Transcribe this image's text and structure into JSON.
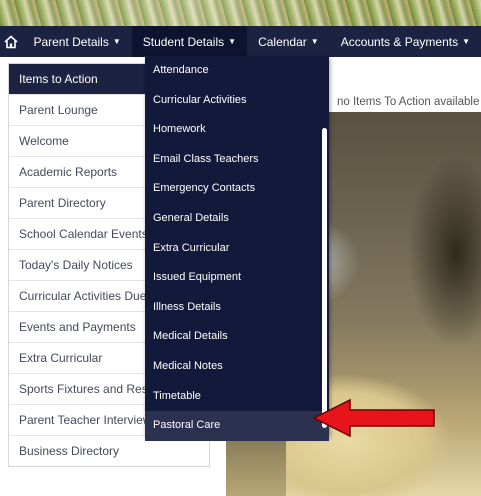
{
  "nav": {
    "home_icon": "home-icon",
    "items": [
      {
        "label": "Parent Details"
      },
      {
        "label": "Student Details"
      },
      {
        "label": "Calendar"
      },
      {
        "label": "Accounts & Payments"
      }
    ]
  },
  "sidebar": {
    "items": [
      {
        "label": "Items to Action"
      },
      {
        "label": "Parent Lounge"
      },
      {
        "label": "Welcome"
      },
      {
        "label": "Academic Reports"
      },
      {
        "label": "Parent Directory"
      },
      {
        "label": "School Calendar Events"
      },
      {
        "label": "Today's Daily Notices"
      },
      {
        "label": "Curricular Activities Due"
      },
      {
        "label": "Events and Payments"
      },
      {
        "label": "Extra Curricular"
      },
      {
        "label": "Sports Fixtures and Res"
      },
      {
        "label": "Parent Teacher Interview"
      },
      {
        "label": "Business Directory"
      }
    ]
  },
  "main": {
    "notice": "no Items To Action available"
  },
  "dropdown": {
    "items": [
      {
        "label": "Attendance"
      },
      {
        "label": "Curricular Activities"
      },
      {
        "label": "Homework"
      },
      {
        "label": "Email Class Teachers"
      },
      {
        "label": "Emergency Contacts"
      },
      {
        "label": "General Details"
      },
      {
        "label": "Extra Curricular"
      },
      {
        "label": "Issued Equipment"
      },
      {
        "label": "Illness Details"
      },
      {
        "label": "Medical Details"
      },
      {
        "label": "Medical Notes"
      },
      {
        "label": "Timetable"
      },
      {
        "label": "Pastoral Care"
      }
    ]
  },
  "colors": {
    "navbar": "#1c2342",
    "dropdown": "#13193a",
    "arrow": "#e8141c"
  }
}
